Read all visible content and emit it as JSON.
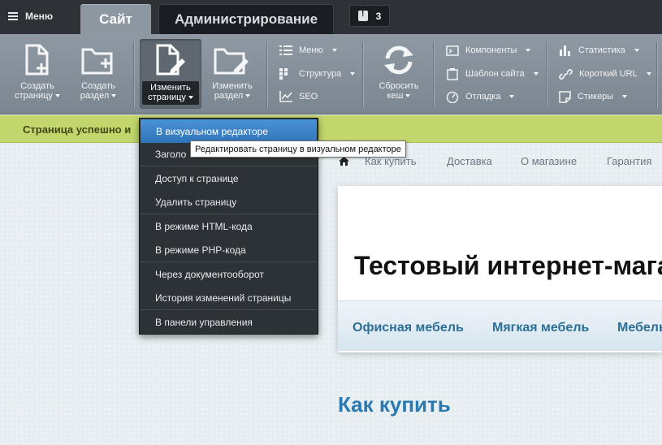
{
  "topbar": {
    "menu_label": "Меню",
    "tab_site": "Сайт",
    "tab_admin": "Администрирование",
    "notifications_count": "3"
  },
  "toolbar": {
    "create_page": {
      "line1": "Создать",
      "line2": "страницу"
    },
    "create_section": {
      "line1": "Создать",
      "line2": "раздел"
    },
    "edit_page": {
      "line1": "Изменить",
      "line2": "страницу"
    },
    "edit_section": {
      "line1": "Изменить",
      "line2": "раздел"
    },
    "menu": "Меню",
    "structure": "Структура",
    "seo": "SEO",
    "reset_cache": {
      "line1": "Сбросить",
      "line2": "кеш"
    },
    "components": "Компоненты",
    "site_template": "Шаблон сайта",
    "debug": "Отладка",
    "statistics": "Статистика",
    "short_url": "Короткий URL",
    "stickers": "Стикеры"
  },
  "success_message": "Страница успешно и",
  "dropdown": {
    "items": [
      "В визуальном редакторе",
      "Заголо",
      "Доступ к странице",
      "Удалить страницу",
      "В режиме HTML-кода",
      "В режиме PHP-кода",
      "Через документооборот",
      "История изменений страницы",
      "В панели управления"
    ],
    "tooltip": "Редактировать страницу в визуальном редакторе"
  },
  "site": {
    "topnav": [
      "Как купить",
      "Доставка",
      "О магазине",
      "Гарантия"
    ],
    "store_title": "Тестовый интернет-мага",
    "categories": [
      "Офисная мебель",
      "Мягкая мебель",
      "Мебель"
    ],
    "page_heading": "Как купить"
  },
  "colors": {
    "topbar_bg": "#2e3237",
    "toolbar_bg": "#8f99a3",
    "success_bg": "#c2d66c",
    "dropdown_bg": "#2d3237",
    "selected_item": "#3a82c8",
    "link_blue": "#2a7ab0"
  }
}
